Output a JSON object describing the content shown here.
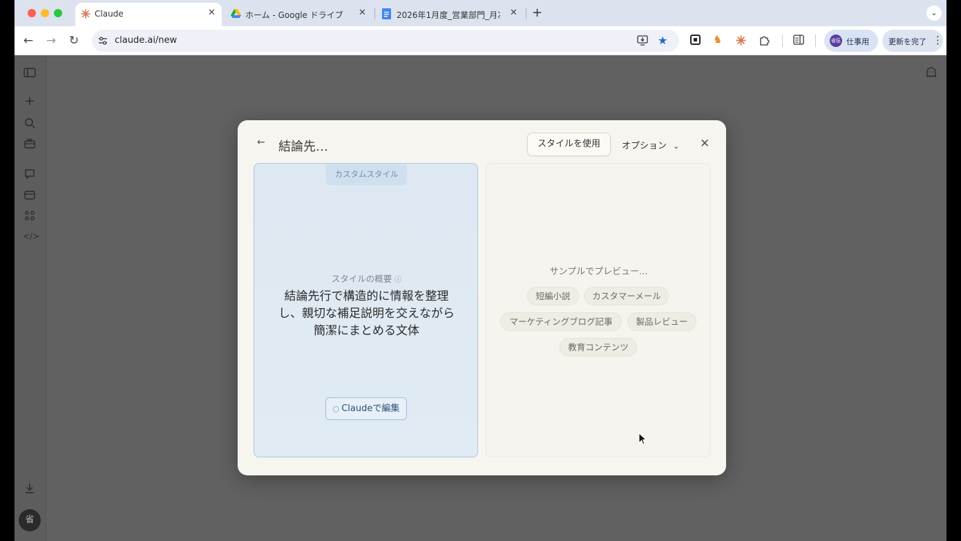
{
  "browser": {
    "tabs": [
      {
        "title": "Claude",
        "active": true
      },
      {
        "title": "ホーム - Google ドライブ",
        "active": false
      },
      {
        "title": "2026年1月度_営業部門_月次レ",
        "active": false
      }
    ],
    "address_bar": {
      "url": "claude.ai/new"
    },
    "profile_label": "仕事用",
    "profile_initials": "省伍",
    "update_label": "更新を完了"
  },
  "sidebar": {
    "avatar_initial": "省"
  },
  "modal": {
    "title": "結論先…",
    "use_style_button": "スタイルを使用",
    "options_label": "オプション",
    "left_card": {
      "tag": "カスタムスタイル",
      "summary_label": "スタイルの概要",
      "summary_text": "結論先行で構造的に情報を整理\nし、親切な補足説明を交えながら\n簡潔にまとめる文体",
      "edit_button": "Claudeで編集"
    },
    "right_card": {
      "preview_label": "サンプルでプレビュー...",
      "chips": [
        "短編小説",
        "カスタマーメール",
        "マーケティングブログ記事",
        "製品レビュー",
        "教育コンテンツ"
      ]
    }
  },
  "colors": {
    "accent_claude": "#d97757",
    "selected_card_border": "#a9c7e5"
  }
}
